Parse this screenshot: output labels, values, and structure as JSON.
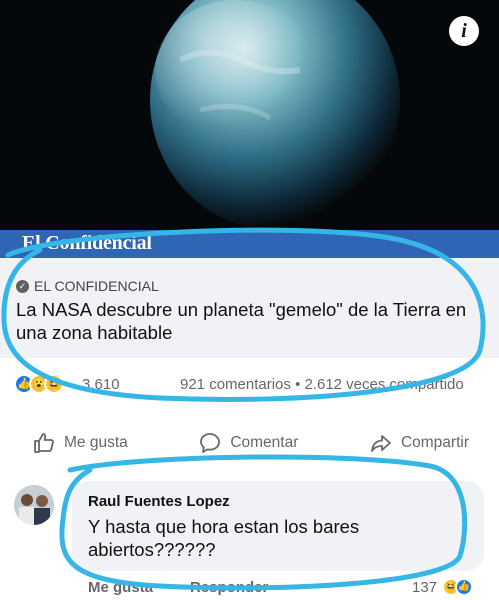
{
  "hero": {
    "info_label": "i"
  },
  "brand": {
    "logo_text": "El Confidencial"
  },
  "preview": {
    "source": "EL CONFIDENCIAL",
    "headline": "La NASA descubre un planeta \"gemelo\" de la Tierra en una zona habitable"
  },
  "stats": {
    "reaction_count": "3.610",
    "comments_shares": "921 comentarios • 2.612 veces compartido"
  },
  "actions": {
    "like": "Me gusta",
    "comment": "Comentar",
    "share": "Compartir"
  },
  "comment": {
    "author": "Raul Fuentes Lopez",
    "text": "Y hasta que hora estan los bares abiertos??????",
    "like_label": "Me gusta",
    "reply_label": "Responder",
    "reaction_count": "137"
  },
  "colors": {
    "brand_blue": "#2e66b5",
    "fb_blue": "#1877f2",
    "marker_cyan": "#35b6e6"
  },
  "icons": {
    "info": "info-icon",
    "source": "globe-icon",
    "like": "thumbs-up-icon",
    "comment": "speech-bubble-icon",
    "share": "share-arrow-icon"
  }
}
